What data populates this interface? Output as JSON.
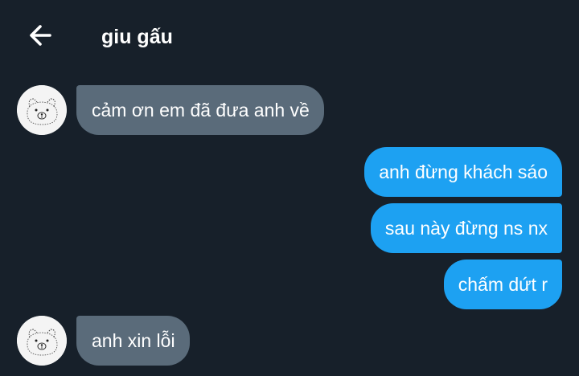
{
  "header": {
    "title": "giu gấu",
    "back_icon": "arrow-left-icon"
  },
  "avatar": {
    "icon": "bear-face-icon"
  },
  "messages": [
    {
      "direction": "incoming",
      "text": "cảm ơn em đã đưa anh về"
    },
    {
      "direction": "outgoing",
      "text": "anh đừng khách sáo"
    },
    {
      "direction": "outgoing",
      "text": "sau này đừng ns nx"
    },
    {
      "direction": "outgoing",
      "text": "chấm dứt r"
    },
    {
      "direction": "incoming",
      "text": "anh xin lỗi"
    }
  ],
  "colors": {
    "background": "#17202a",
    "incoming_bubble": "#5a6b7a",
    "outgoing_bubble": "#1da1f2",
    "text": "#ffffff"
  }
}
